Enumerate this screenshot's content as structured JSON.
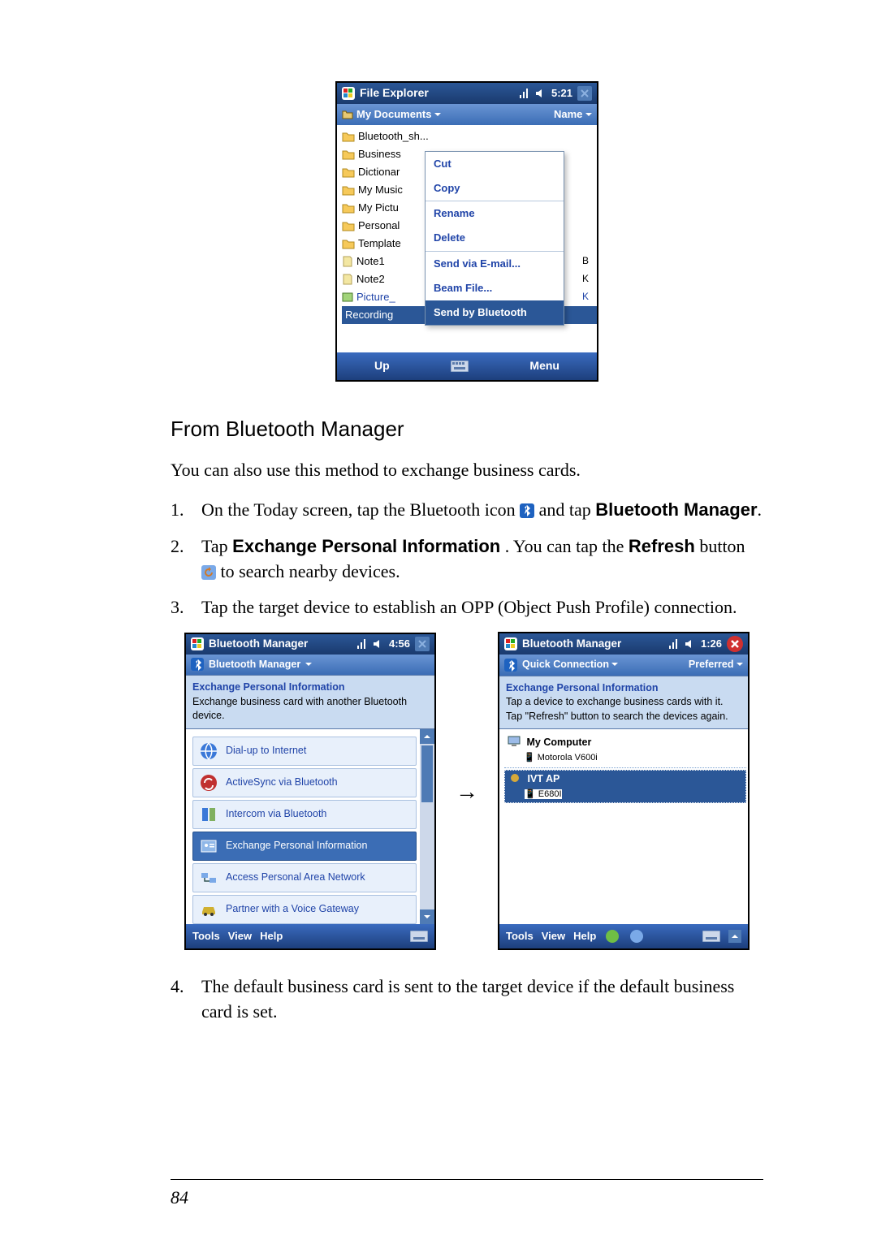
{
  "fe": {
    "title": "File Explorer",
    "clock": "5:21",
    "path": "My Documents",
    "sort": "Name",
    "rows": [
      "Bluetooth_sh...",
      "Business",
      "Dictionar",
      "My Music",
      "My Pictu",
      "Personal",
      "Template"
    ],
    "notes": [
      "Note1",
      "Note2"
    ],
    "picture": "Picture_",
    "recording": "Recording",
    "side_letters": [
      "B",
      "K",
      "K"
    ],
    "ctx": {
      "cut": "Cut",
      "copy": "Copy",
      "rename": "Rename",
      "delete": "Delete",
      "email": "Send via E-mail...",
      "beam": "Beam File...",
      "sendbt": "Send by Bluetooth"
    },
    "up": "Up",
    "menu": "Menu"
  },
  "section_title": "From Bluetooth Manager",
  "intro": "You can also use this method to exchange business cards.",
  "steps": {
    "s1a": "On the Today screen, tap the Bluetooth icon ",
    "s1b": " and tap ",
    "s1c": "Bluetooth Manager",
    "s1d": ".",
    "s2a": "Tap ",
    "s2b": "Exchange Personal Information",
    "s2c": ". You can tap the ",
    "s2d": "Refresh",
    "s2e": " button ",
    "s2f": " to search nearby devices.",
    "s3": "Tap the target device to establish an OPP (Object Push Profile) connection.",
    "s4": "The default business card is sent to the target device if the default business card is set."
  },
  "bm_left": {
    "title": "Bluetooth Manager",
    "clock": "4:56",
    "toolbar": "Bluetooth Manager",
    "sub_title": "Exchange Personal Information",
    "sub_desc": "Exchange business card with another Bluetooth device.",
    "items": [
      "Dial-up to Internet",
      "ActiveSync via Bluetooth",
      "Intercom via Bluetooth",
      "Exchange Personal Information",
      "Access Personal Area Network",
      "Partner with a Voice Gateway"
    ],
    "bottom": [
      "Tools",
      "View",
      "Help"
    ]
  },
  "bm_right": {
    "title": "Bluetooth Manager",
    "clock": "1:26",
    "quick": "Quick Connection",
    "pref": "Preferred",
    "sub_title": "Exchange Personal Information",
    "sub_desc": "Tap a device to exchange business cards with it. Tap \"Refresh\" button to search the devices again.",
    "devs": [
      {
        "name": "My Computer",
        "sub": "Motorola V600i"
      },
      {
        "name": "IVT AP",
        "sub": "E680I"
      }
    ],
    "bottom": [
      "Tools",
      "View",
      "Help"
    ]
  },
  "page_number": "84"
}
